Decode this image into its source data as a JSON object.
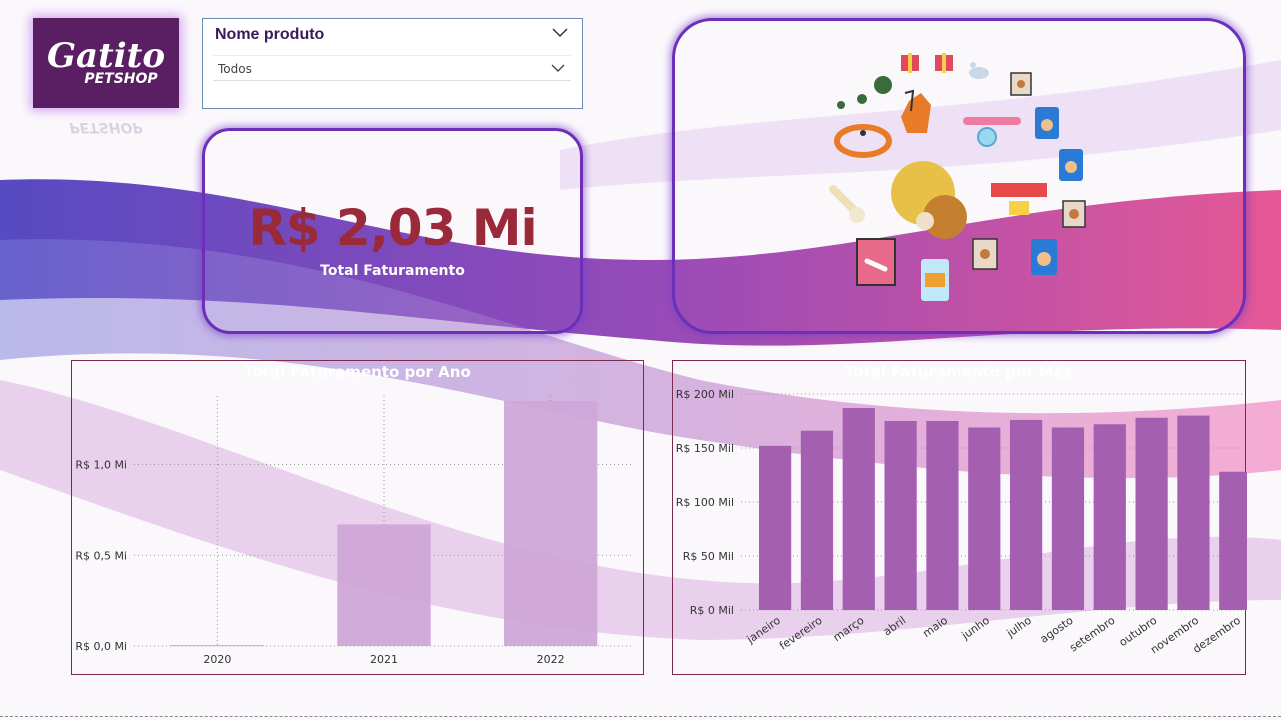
{
  "logo": {
    "brand": "Gatito",
    "sub": "PETSHOP"
  },
  "slicer": {
    "title": "Nome produto",
    "selected": "Todos"
  },
  "kpi": {
    "value": "R$ 2,03 Mi",
    "label": "Total Faturamento"
  },
  "icons": [
    "gift-icon",
    "gift-icon",
    "mouse-toy-icon",
    "cat-food-box-icon",
    "frog-toy-icon",
    "dog-icon",
    "collar-icon",
    "cat-food-bag-icon",
    "collar-icon",
    "bone-icon",
    "yarn-ball-icon",
    "cat-food-bag-icon",
    "bow-collar-icon",
    "cat-food-box-icon",
    "treat-bag-icon",
    "cat-food-box-icon",
    "cat-food-can-icon",
    "cat-food-bag-icon"
  ],
  "charts": {
    "year": {
      "title": "Total Faturamento por Ano",
      "yticks": [
        "R$ 0,0 Mi",
        "R$ 0,5 Mi",
        "R$ 1,0 Mi"
      ]
    },
    "month": {
      "title": "Total Faturamento por Mês",
      "yticks": [
        "R$ 0 Mil",
        "R$ 50 Mil",
        "R$ 100 Mil",
        "R$ 150 Mil",
        "R$ 200 Mil"
      ]
    }
  },
  "chart_data": [
    {
      "type": "bar",
      "title": "Total Faturamento por Ano",
      "categories": [
        "2020",
        "2021",
        "2022"
      ],
      "values": [
        0.005,
        0.67,
        1.35
      ],
      "unit": "Mi",
      "ylim": [
        0,
        1.35
      ],
      "color": "#cfa6d8"
    },
    {
      "type": "bar",
      "title": "Total Faturamento por Mês",
      "categories": [
        "janeiro",
        "fevereiro",
        "março",
        "abril",
        "maio",
        "junho",
        "julho",
        "agosto",
        "setembro",
        "outubro",
        "novembro",
        "dezembro"
      ],
      "values": [
        152,
        166,
        187,
        175,
        175,
        169,
        176,
        169,
        172,
        178,
        180,
        128
      ],
      "unit": "Mil",
      "ylim": [
        0,
        200
      ],
      "color": "#a55fb0"
    }
  ]
}
